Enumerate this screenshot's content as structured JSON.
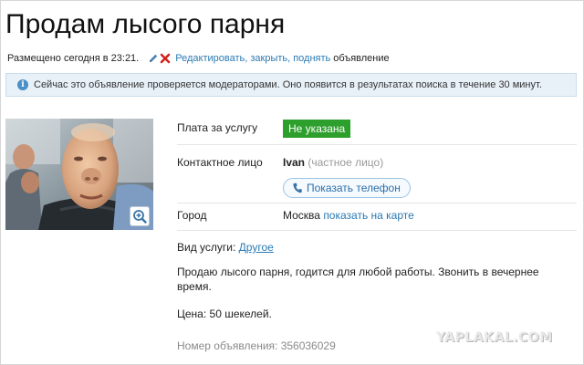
{
  "ad": {
    "title": "Продам лысого парня",
    "posted": "Размещено сегодня в 23:21.",
    "actions_label": "Редактировать, закрыть, поднять",
    "actions_suffix": "объявление"
  },
  "notice": {
    "icon": "info-icon",
    "text": "Сейчас это объявление проверяется модераторами. Оно появится в результатах поиска в течение 30 минут."
  },
  "details": {
    "price_label": "Плата за услугу",
    "price_value": "Не указана",
    "contact_label": "Контактное лицо",
    "contact_name": "Ivan",
    "contact_type": "(частное лицо)",
    "phone_button": "Показать телефон",
    "city_label": "Город",
    "city_value": "Москва",
    "map_link": "показать на карте"
  },
  "service": {
    "label": "Вид услуги:",
    "value": "Другое"
  },
  "description": {
    "text": "Продаю лысого парня, годится для любой работы. Звонить в вечернее время.",
    "price_line": "Цена: 50 шекелей."
  },
  "footer": {
    "ad_number": "Номер объявления: 356036029",
    "watermark": "YAPLAKAL.COM"
  },
  "colors": {
    "link": "#2a7ab4",
    "badge": "#2d9f2d",
    "notice_bg": "#e8f1f8"
  }
}
